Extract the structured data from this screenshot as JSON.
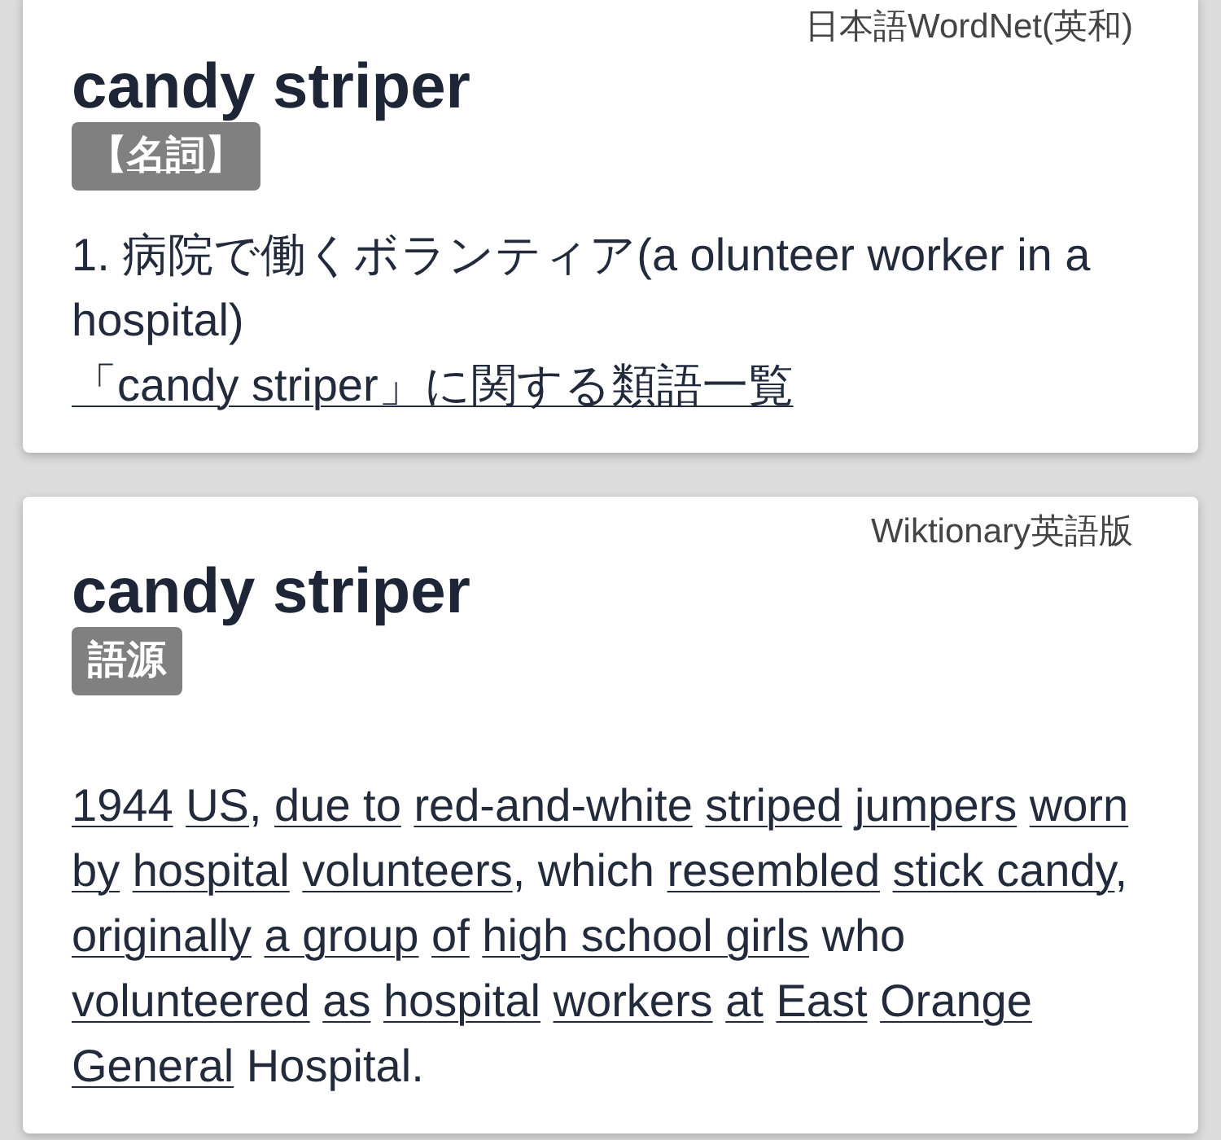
{
  "entries": [
    {
      "source": "日本語WordNet(英和)",
      "headword": "candy striper",
      "tag": {
        "before": "【",
        "link": "名詞",
        "after": "】"
      },
      "definitions": [
        "1. 病院で働くボランティア(a olunteer worker in a hospital)"
      ],
      "synonyms_link": "「candy striper」に関する類語一覧"
    },
    {
      "source": "Wiktionary英語版",
      "headword": "candy striper",
      "tag": {
        "text": "語源"
      },
      "body": [
        {
          "text": "1944"
        },
        {
          "text": "US",
          "tail": ","
        },
        {
          "text": "due to"
        },
        {
          "text": "red-and-white"
        },
        {
          "text": "striped"
        },
        {
          "text": "jumpers"
        },
        {
          "text": "worn"
        },
        {
          "text": "by"
        },
        {
          "text": "hospital"
        },
        {
          "text": "volunteers",
          "tail": ", which"
        },
        {
          "text": "resembled"
        },
        {
          "text": "stick candy",
          "tail": ","
        },
        {
          "text": "originally"
        },
        {
          "text": "a group"
        },
        {
          "text": "of"
        },
        {
          "text": "high school girls",
          "tail": " who"
        },
        {
          "text": "volunteered"
        },
        {
          "text": "as"
        },
        {
          "text": "hospital"
        },
        {
          "text": "workers"
        },
        {
          "text": "at"
        },
        {
          "text": "East"
        },
        {
          "text": "Orange"
        },
        {
          "text": "General",
          "tail": " Hospital."
        }
      ]
    }
  ]
}
